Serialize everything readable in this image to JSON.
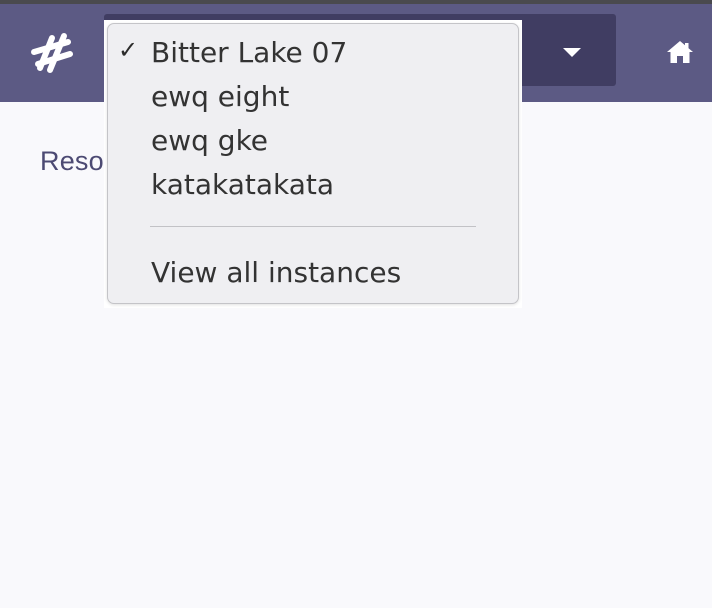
{
  "header": {
    "logo_icon": "brand-logo-icon",
    "home_icon": "home-icon",
    "caret_icon": "chevron-down-icon",
    "colors": {
      "navbar": "#5c5a84",
      "selector": "#403d62",
      "topline": "#4a4a4e"
    }
  },
  "page": {
    "heading": "Reso"
  },
  "instance_menu": {
    "check_mark": "✓",
    "items": [
      {
        "label": "Bitter Lake 07",
        "selected": true
      },
      {
        "label": "ewq eight",
        "selected": false
      },
      {
        "label": "ewq gke",
        "selected": false
      },
      {
        "label": "katakatakata",
        "selected": false
      }
    ],
    "view_all_label": "View all instances"
  }
}
